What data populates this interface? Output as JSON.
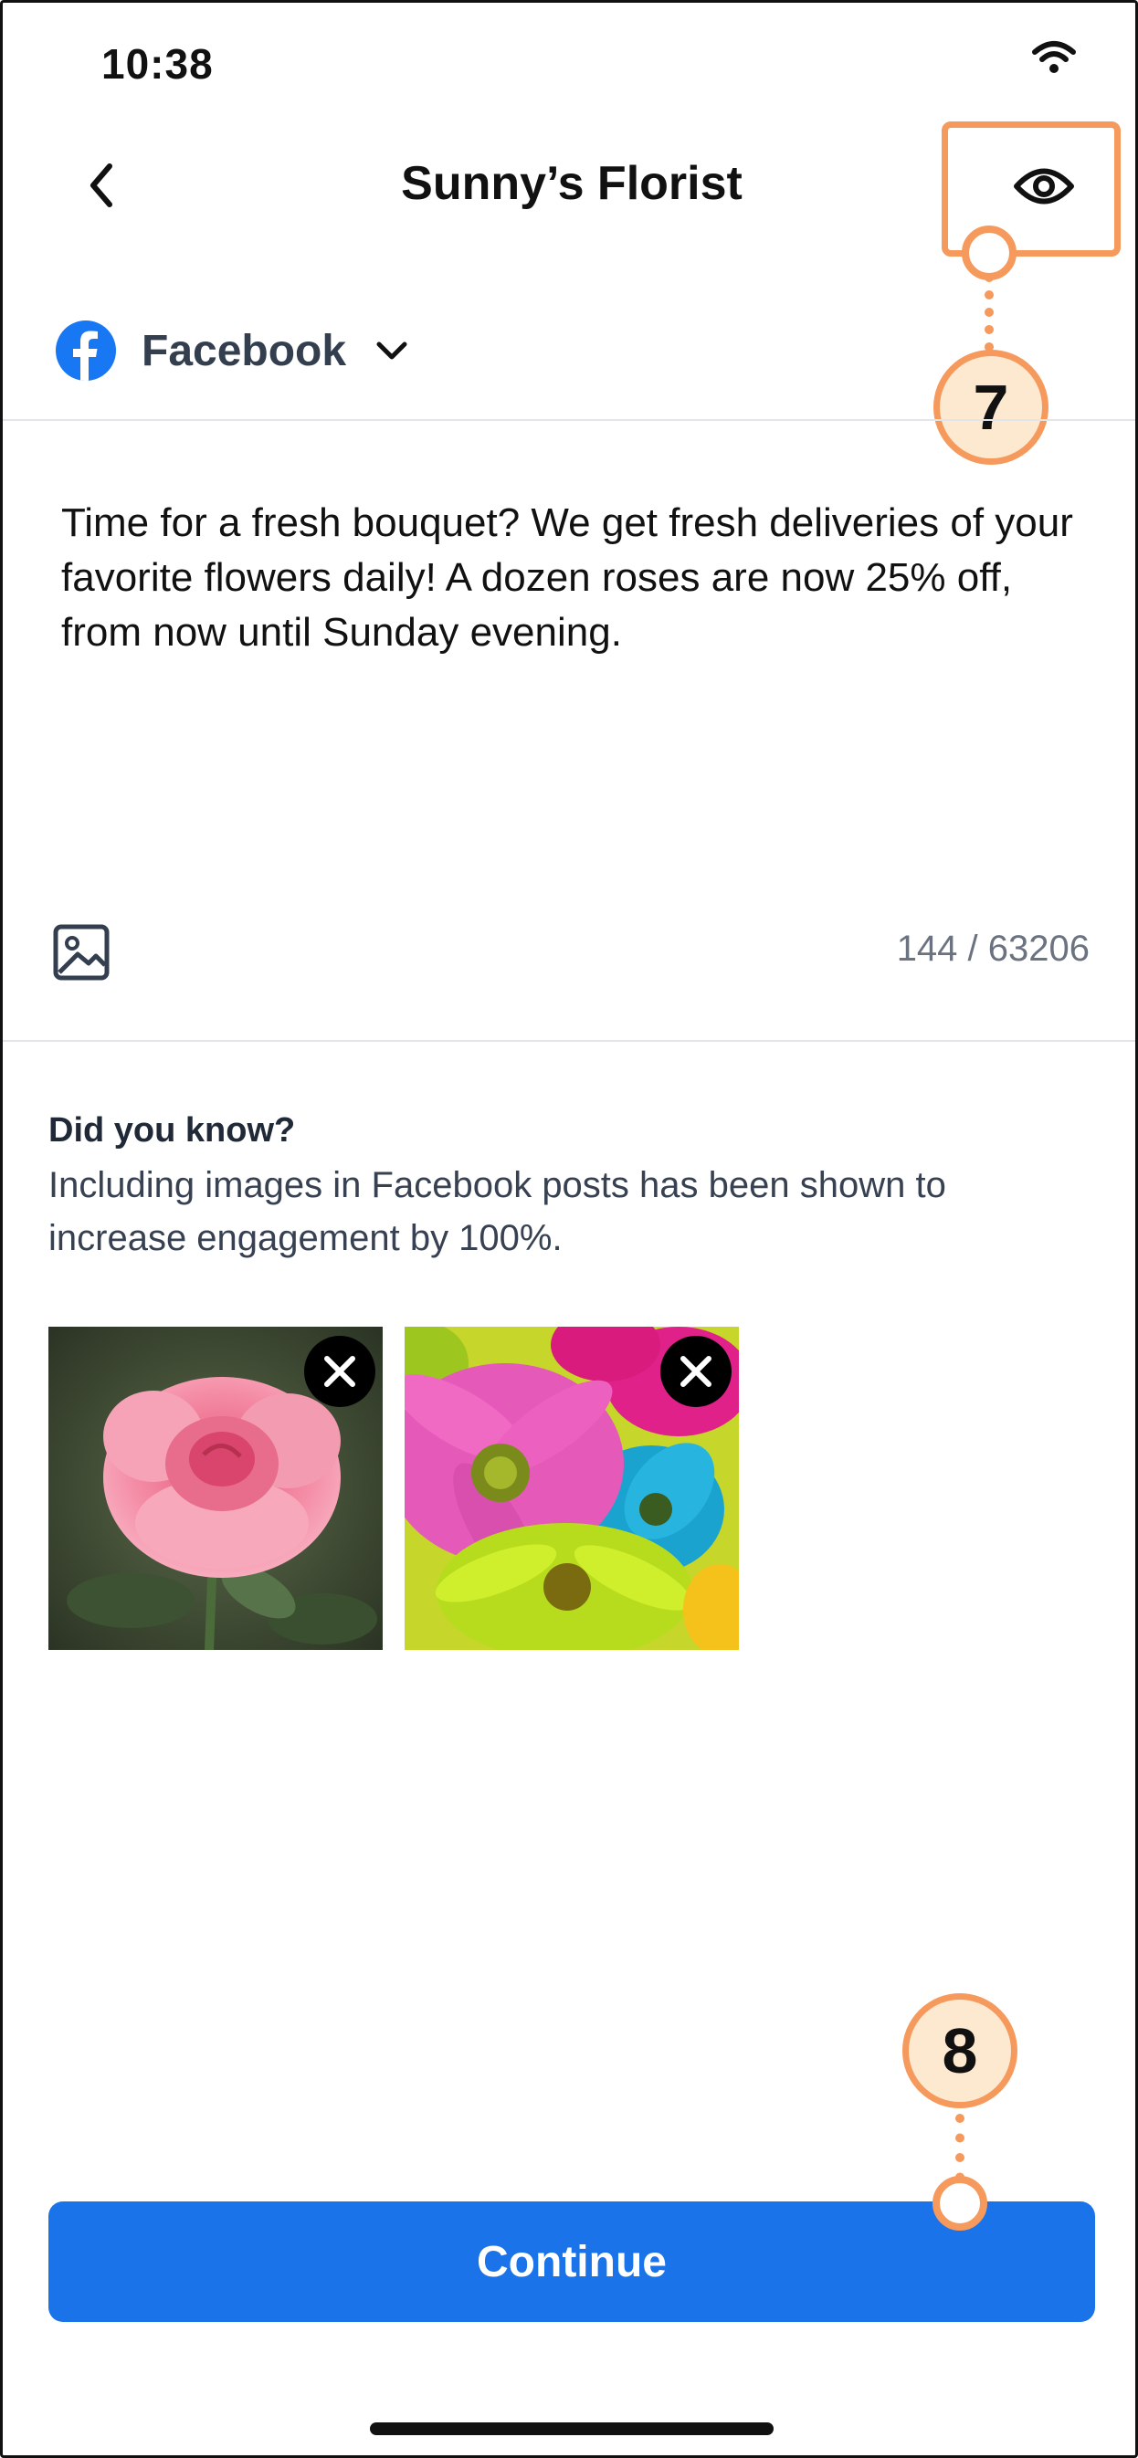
{
  "status_bar": {
    "time": "10:38",
    "wifi_icon": "wifi-icon"
  },
  "header": {
    "title": "Sunny’s Florist",
    "back_icon": "chevron-left-icon",
    "preview_icon": "eye-icon"
  },
  "platform_selector": {
    "label": "Facebook",
    "icon": "facebook-icon",
    "chevron_icon": "chevron-down-icon"
  },
  "post": {
    "text": "Time for a fresh bouquet? We get fresh deliveries of your favorite flowers daily! A dozen roses are now 25% off, from now until Sunday evening.",
    "char_count": "144 / 63206",
    "add_image_icon": "image-icon"
  },
  "tip": {
    "title": "Did you know?",
    "body": "Including images in Facebook posts has been shown to increase engagement by 100%."
  },
  "attachments": [
    {
      "subject": "pink rose",
      "remove_icon": "close-icon"
    },
    {
      "subject": "colorful daisies",
      "remove_icon": "close-icon"
    }
  ],
  "callouts": {
    "first": "7",
    "second": "8"
  },
  "continue_button": {
    "label": "Continue"
  },
  "colors": {
    "accent": "#1a73e8",
    "facebook": "#1877f2",
    "callout": "#f59a5c",
    "callout_fill": "#fde8d0"
  }
}
